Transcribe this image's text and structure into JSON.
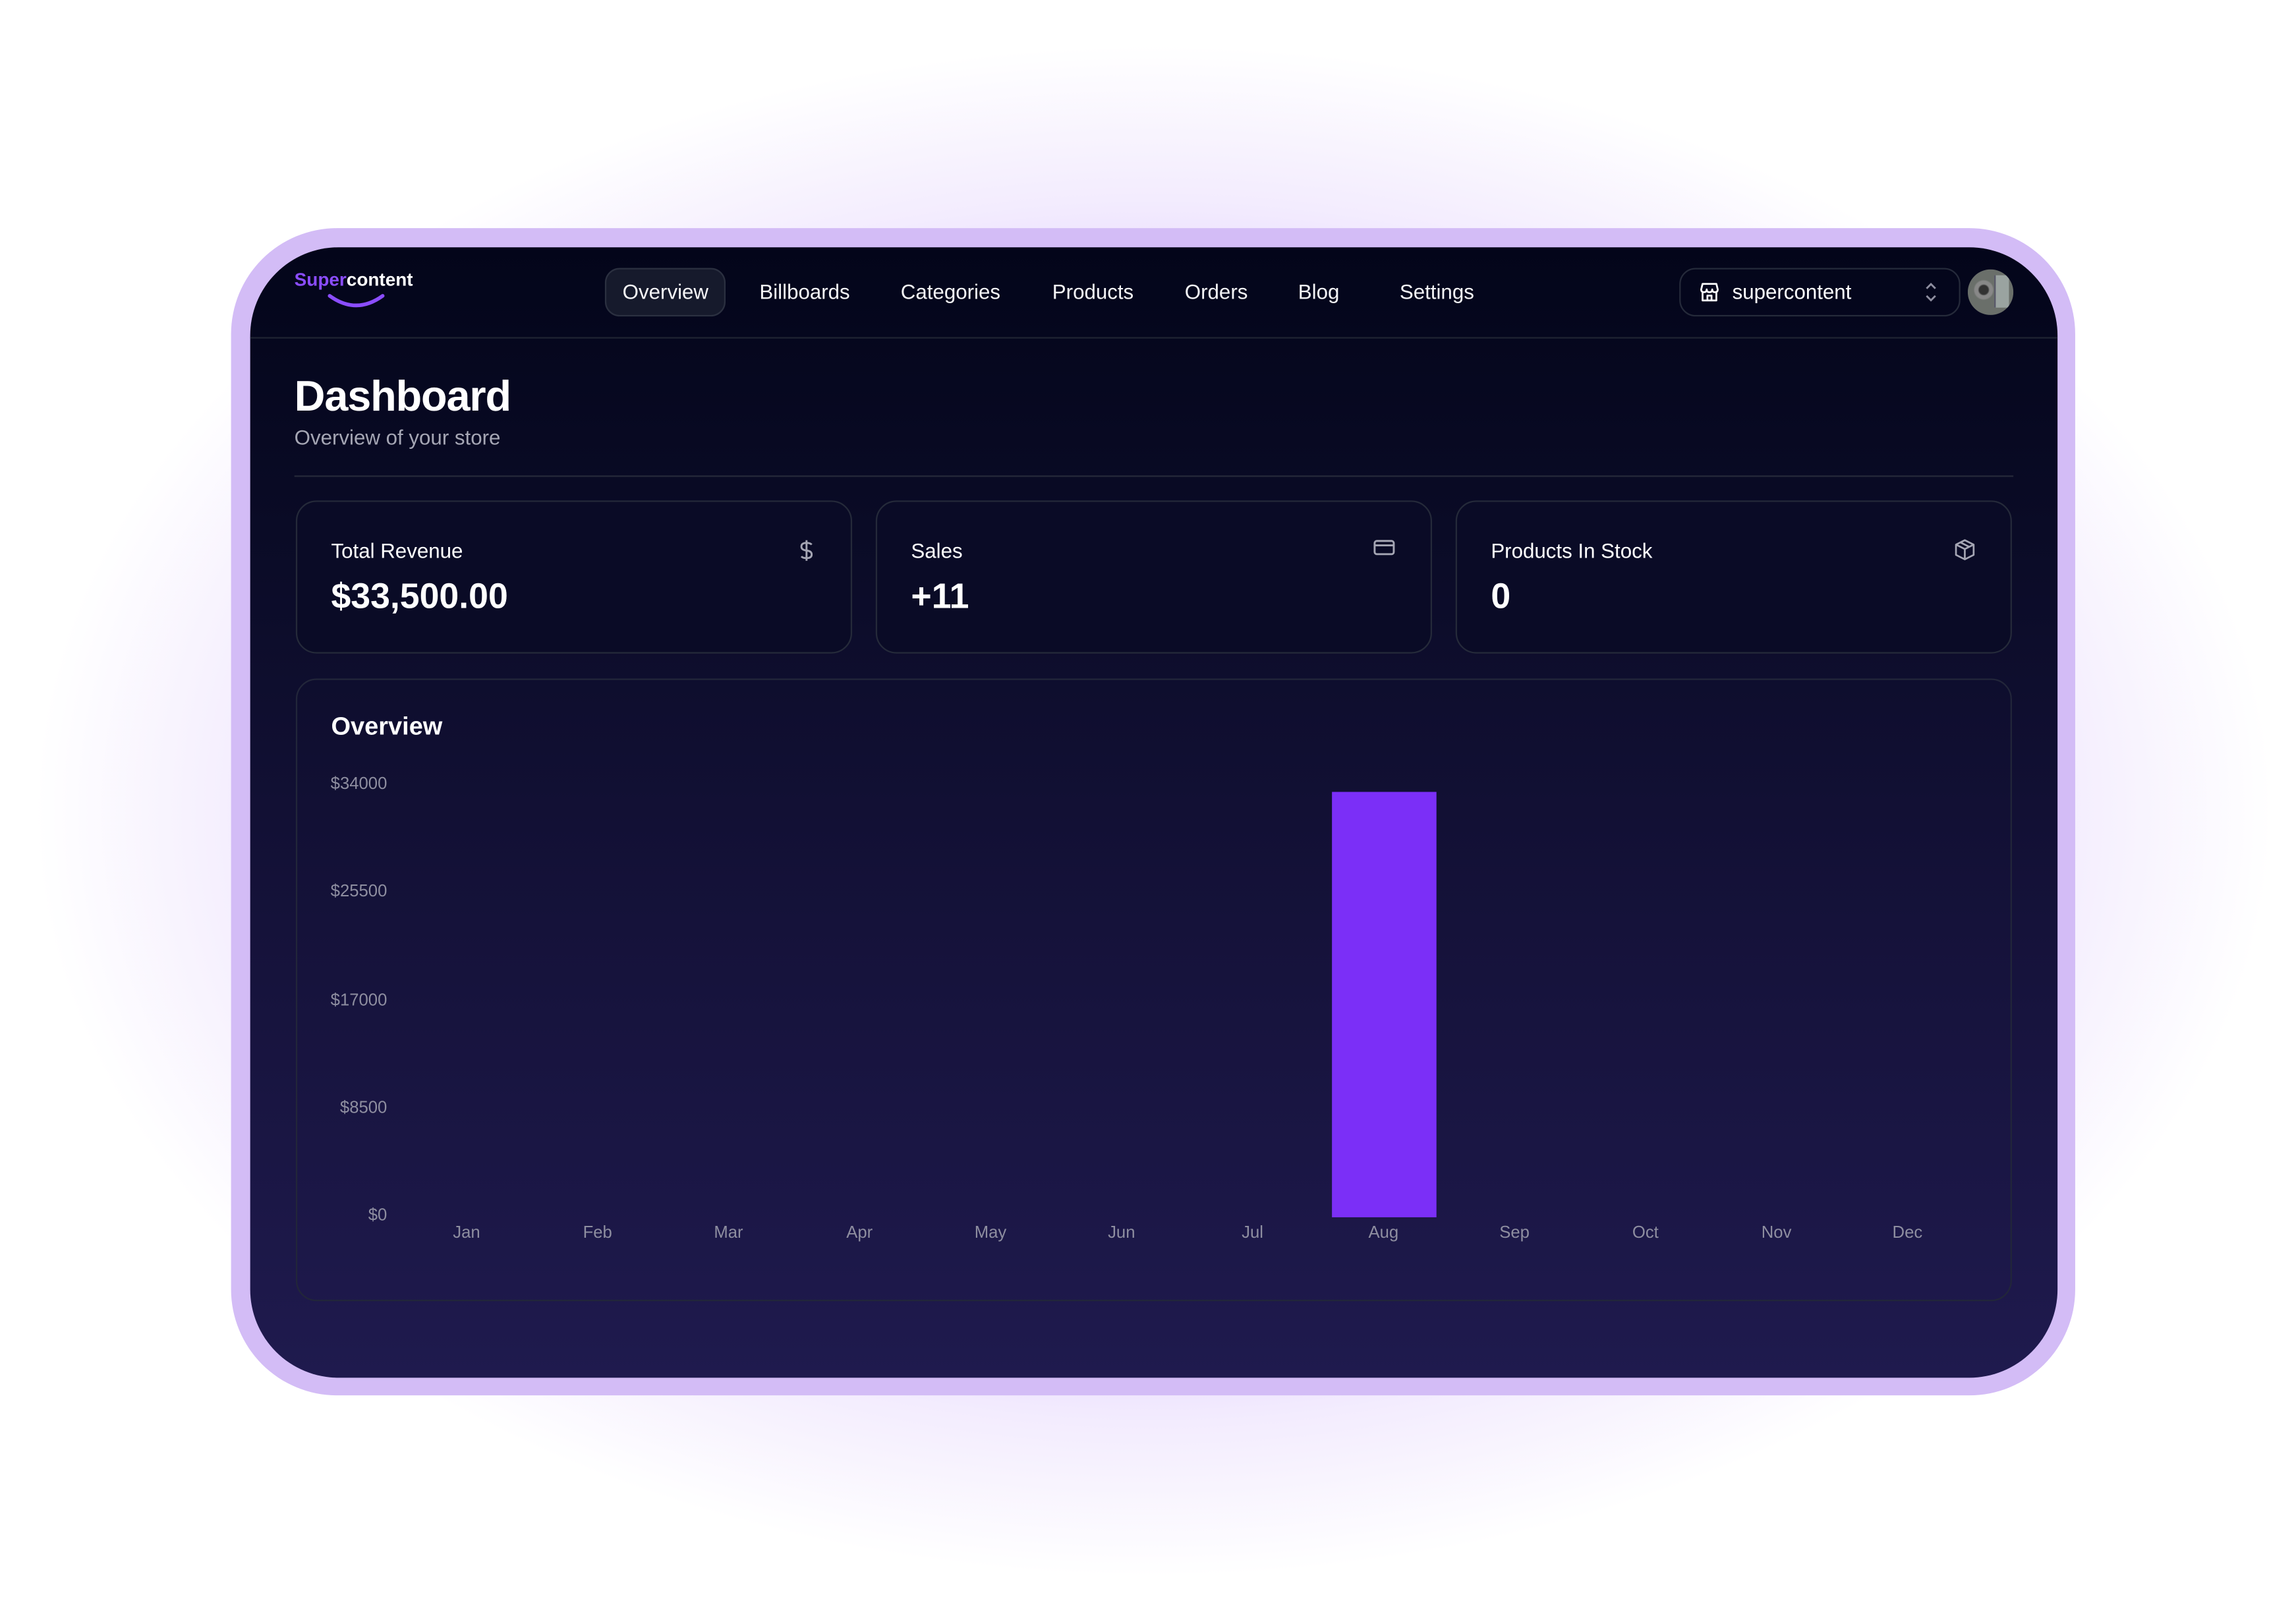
{
  "brand": {
    "logo_part1": "Super",
    "logo_part2": "content"
  },
  "nav": {
    "items": [
      {
        "label": "Overview",
        "active": true
      },
      {
        "label": "Billboards"
      },
      {
        "label": "Categories"
      },
      {
        "label": "Products"
      },
      {
        "label": "Orders"
      },
      {
        "label": "Blog"
      },
      {
        "label": "Settings"
      }
    ]
  },
  "store_switcher": {
    "value": "supercontent",
    "icon": "store-icon"
  },
  "header": {
    "title": "Dashboard",
    "subtitle": "Overview of your store"
  },
  "cards": [
    {
      "label": "Total Revenue",
      "value": "$33,500.00",
      "icon": "dollar-icon"
    },
    {
      "label": "Sales",
      "value": "+11",
      "icon": "credit-card-icon"
    },
    {
      "label": "Products In Stock",
      "value": "0",
      "icon": "package-icon"
    }
  ],
  "colors": {
    "accent": "#7b2ff7",
    "frame": "#d3bcf6"
  },
  "chart_data": {
    "type": "bar",
    "title": "Overview",
    "categories": [
      "Jan",
      "Feb",
      "Mar",
      "Apr",
      "May",
      "Jun",
      "Jul",
      "Aug",
      "Sep",
      "Oct",
      "Nov",
      "Dec"
    ],
    "values": [
      0,
      0,
      0,
      0,
      0,
      0,
      0,
      33500,
      0,
      0,
      0,
      0
    ],
    "yticks": [
      "$0",
      "$8500",
      "$17000",
      "$25500",
      "$34000"
    ],
    "ylim": [
      0,
      34000
    ],
    "grid": false,
    "color": "#7b2ff7"
  }
}
